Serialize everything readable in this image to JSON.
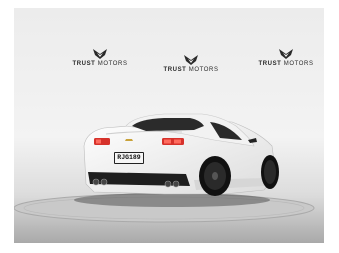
{
  "branding": {
    "logos": [
      {
        "strong": "TRUST",
        "light": "MOTORS"
      },
      {
        "strong": "TRUST",
        "light": "MOTORS"
      },
      {
        "strong": "TRUST",
        "light": "MOTORS"
      }
    ]
  },
  "car": {
    "plate": "RJG189",
    "color": "#f7f7f7",
    "taillight_color": "#d6322b"
  },
  "scene": {
    "backdrop_color": "#ececec",
    "turntable_color": "#cfcfcf"
  }
}
